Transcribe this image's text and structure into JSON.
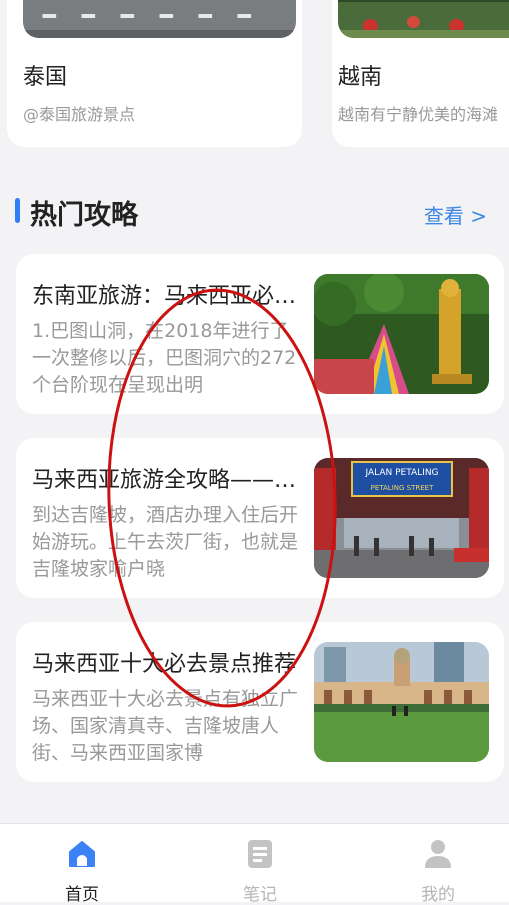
{
  "destinations": [
    {
      "name": "泰国",
      "desc": "@泰国旅游景点"
    },
    {
      "name": "越南",
      "desc": "越南有宁静优美的海滩"
    }
  ],
  "section": {
    "title": "热门攻略",
    "more": "查看 >"
  },
  "guides": [
    {
      "title": "东南亚旅游：马来西亚必去景点",
      "summary": "1.巴图山洞，在2018年进行了一次整修以后，巴图洞穴的272个台阶现在呈现出明"
    },
    {
      "title": "马来西亚旅游全攻略——吉隆坡",
      "summary": "到达吉隆坡，酒店办理入住后开始游玩。上午去茨厂街，也就是吉隆坡家喻户晓"
    },
    {
      "title": "马来西亚十大必去景点推荐",
      "summary": "马来西亚十大必去景点有独立广场、国家清真寺、吉隆坡唐人街、马来西亚国家博"
    }
  ],
  "guide_thumb_sign": [
    "JALAN PETALING",
    "PETALING STREET"
  ],
  "tabs": [
    {
      "label": "首页",
      "active": true
    },
    {
      "label": "笔记",
      "active": false
    },
    {
      "label": "我的",
      "active": false
    }
  ],
  "colors": {
    "accent": "#2f7ef7",
    "link": "#3a86e8",
    "annotation": "#cc1111"
  }
}
